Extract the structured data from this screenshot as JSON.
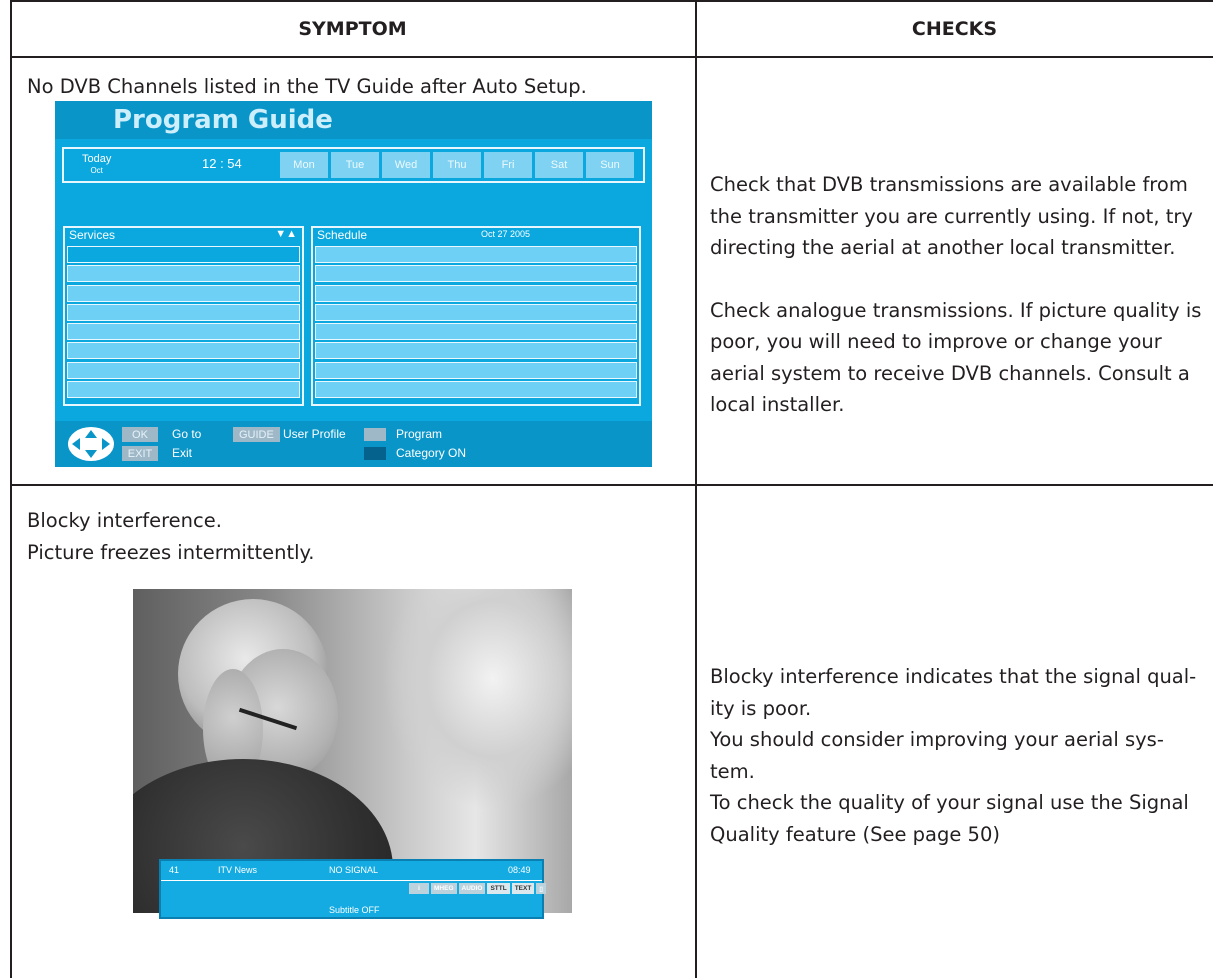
{
  "table": {
    "headers": {
      "symptom": "SYMPTOM",
      "checks": "CHECKS"
    },
    "rows": [
      {
        "symptom": "No DVB Channels listed in the TV Guide after Auto Setup.",
        "checks": [
          "Check that DVB transmissions are available from the transmitter you are currently using. If not, try directing the aerial at another local transmitter.",
          "Check analogue transmissions. If picture quality is poor, you will need to improve or change your aerial system to receive DVB channels. Consult a local installer."
        ]
      },
      {
        "symptom_lines": [
          "Blocky interference.",
          "Picture freezes intermittently."
        ],
        "checks_lines": [
          "Blocky interference indicates that the signal qual-",
          "ity is poor.",
          "You should consider improving your aerial sys-",
          "tem.",
          "To check the quality of your signal use the Signal",
          "Quality feature (See page 50)"
        ]
      }
    ]
  },
  "program_guide": {
    "title": "Program Guide",
    "today": "Today",
    "month": "Oct",
    "time": "12 : 54",
    "days": [
      "Mon",
      "Tue",
      "Wed",
      "Thu",
      "Fri",
      "Sat",
      "Sun"
    ],
    "services_label": "Services",
    "sort_icon": "▼▲",
    "schedule_label": "Schedule",
    "schedule_date": "Oct 27  2005",
    "keys": {
      "ok": "OK",
      "ok_action": "Go to",
      "exit": "EXIT",
      "exit_action": "Exit",
      "guide": "GUIDE",
      "guide_action": "User Profile",
      "program": "Program",
      "category": "Category ON"
    },
    "colors": {
      "background": "#0aa8df",
      "row": "#6fd0f5",
      "bar": "#0a95c9"
    }
  },
  "osd": {
    "channel": "41",
    "name": "ITV News",
    "status": "NO SIGNAL",
    "time": "08:49",
    "badges": [
      "i",
      "MHEG",
      "AUDIO",
      "STTL",
      "TEXT",
      "▯"
    ],
    "subtitle": "Subtitle OFF"
  }
}
